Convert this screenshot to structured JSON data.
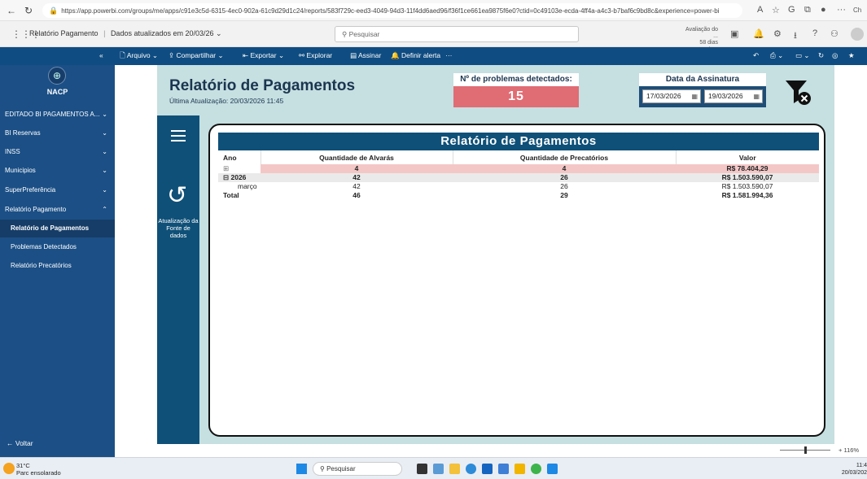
{
  "browser": {
    "url": "https://app.powerbi.com/groups/me/apps/c91e3c5d-6315-4ec0-902a-61c9d29d1c24/reports/583f729c-eed3-4049-94d3-11f4dd6aed96/f36f1ce661ea9875f6e0?ctid=0c49103e-ecda-4ff4a-a4c3-b7baf6c9bd8c&experience=power-bi",
    "profile_label": "Ch"
  },
  "topbar": {
    "app_name": "Relatório Pagamento",
    "data_updated": "Dados atualizados em 20/03/26",
    "search_placeholder": "Pesquisar",
    "trial_line1": "Avaliação do ...",
    "trial_line2": "58 dias resta..."
  },
  "ribbon": {
    "file": "Arquivo",
    "share": "Compartilhar",
    "export": "Exportar",
    "explore": "Explorar",
    "sign": "Assinar",
    "alert": "Definir alerta",
    "more": "···"
  },
  "sidebar": {
    "org": "NACP",
    "items": [
      {
        "label": "EDITADO BI PAGAMENTOS A..."
      },
      {
        "label": "BI Reservas"
      },
      {
        "label": "INSS"
      },
      {
        "label": "Municipios"
      },
      {
        "label": "SuperPreferência"
      },
      {
        "label": "Relatório Pagamento"
      }
    ],
    "subitems": [
      {
        "label": "Relatório de Pagamentos"
      },
      {
        "label": "Problemas Detectados"
      },
      {
        "label": "Relatório Precatórios"
      }
    ],
    "back": "Voltar"
  },
  "report": {
    "title": "Relatório de Pagamentos",
    "updated": "Última Atualização: 20/03/2026 11:45",
    "problems_label": "Nº de problemas detectados:",
    "problems_value": "15",
    "sign_label": "Data da Assinatura",
    "date_from": "17/03/2026",
    "date_to": "19/03/2026",
    "refresh_label": "Atualização da Fonte de dados",
    "colors": {
      "accent": "#0f5078",
      "alert": "#e06d74",
      "canvas": "#c6dfe1"
    }
  },
  "matrix": {
    "title": "Relatório de Pagamentos",
    "headers": [
      "Ano",
      "Quantidade de Alvarás",
      "Quantidade de Precatórios",
      "Valor"
    ],
    "rows": [
      {
        "ano": "⊞",
        "alvaras": "4",
        "precatorios": "4",
        "valor": "R$ 78.404,29"
      },
      {
        "ano": "⊟ 2026",
        "alvaras": "42",
        "precatorios": "26",
        "valor": "R$ 1.503.590,07"
      },
      {
        "ano": "março",
        "alvaras": "42",
        "precatorios": "26",
        "valor": "R$ 1.503.590,07"
      },
      {
        "ano": "Total",
        "alvaras": "46",
        "precatorios": "29",
        "valor": "R$ 1.581.994,36"
      }
    ]
  },
  "status": {
    "zoom": "116%",
    "weather_temp": "31°C",
    "weather_desc": "Parc ensolarado",
    "taskbar_search": "Pesquisar",
    "time": "11:4",
    "date": "20/03/202"
  }
}
